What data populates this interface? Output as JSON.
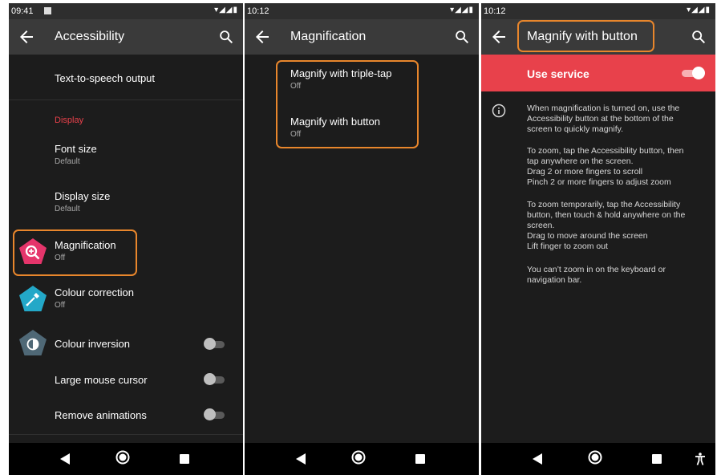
{
  "colors": {
    "accent_red": "#e8414b",
    "highlight_orange": "#e8862c",
    "pink_icon": "#e5356b",
    "teal_icon": "#23a8c8",
    "slate_icon": "#4f6876"
  },
  "screen1": {
    "status_time": "09:41",
    "title": "Accessibility",
    "items": {
      "tts": "Text-to-speech output",
      "section_display": "Display",
      "font_size": {
        "title": "Font size",
        "summary": "Default"
      },
      "display_size": {
        "title": "Display size",
        "summary": "Default"
      },
      "magnification": {
        "title": "Magnification",
        "summary": "Off",
        "icon": "magnify-icon"
      },
      "colour_correction": {
        "title": "Colour correction",
        "summary": "Off",
        "icon": "eyedropper-icon"
      },
      "colour_inversion": {
        "title": "Colour inversion",
        "icon": "contrast-icon",
        "enabled": false
      },
      "large_mouse_cursor": {
        "title": "Large mouse cursor",
        "enabled": false
      },
      "remove_animations": {
        "title": "Remove animations",
        "enabled": false
      }
    }
  },
  "screen2": {
    "status_time": "10:12",
    "title": "Magnification",
    "items": {
      "triple_tap": {
        "title": "Magnify with triple-tap",
        "summary": "Off"
      },
      "button": {
        "title": "Magnify with button",
        "summary": "Off"
      }
    }
  },
  "screen3": {
    "status_time": "10:12",
    "title": "Magnify with button",
    "use_service": {
      "label": "Use service",
      "enabled": true
    },
    "info": {
      "p1": [
        "When magnification is turned on, use the",
        "Accessibility button at the bottom of the",
        "screen to quickly magnify."
      ],
      "p2": [
        "To zoom, tap the Accessibility button, then",
        "tap anywhere on the screen.",
        "Drag 2 or more fingers to scroll",
        "Pinch 2 or more fingers to adjust zoom"
      ],
      "p3": [
        "To zoom temporarily, tap the Accessibility",
        "button, then touch & hold anywhere on the",
        "screen.",
        "Drag to move around the screen",
        "Lift finger to zoom out"
      ],
      "p4": [
        "You can’t zoom in on the keyboard or",
        "navigation bar."
      ]
    }
  }
}
